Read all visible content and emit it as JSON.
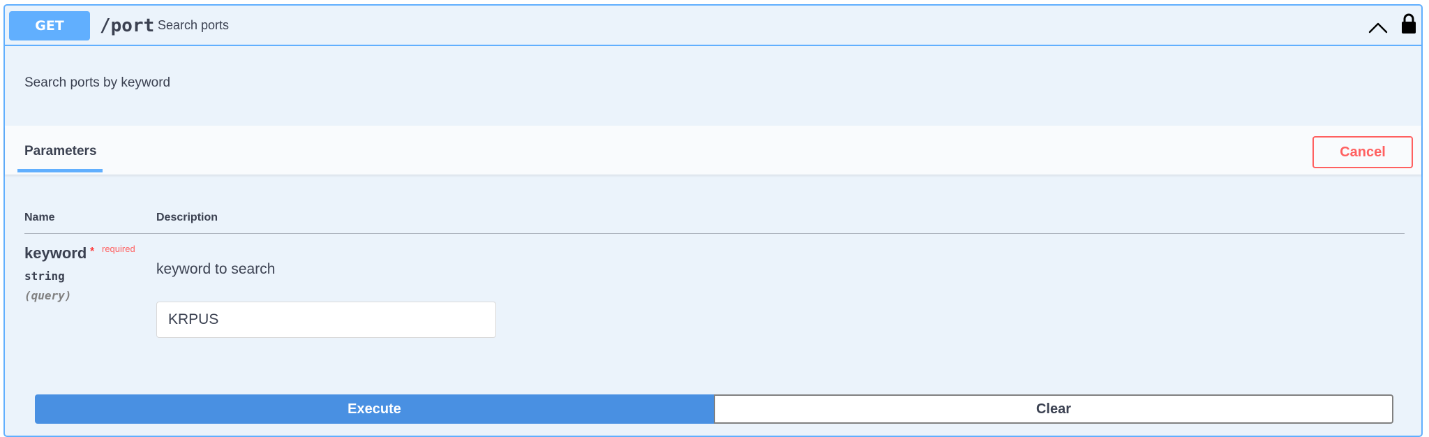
{
  "operation": {
    "method": "GET",
    "path": "/port",
    "summary": "Search ports",
    "description": "Search ports by keyword",
    "method_color": "#61affe"
  },
  "icons": {
    "collapse": "chevron-up-icon",
    "auth": "lock-icon"
  },
  "parameters_section": {
    "tab_label": "Parameters",
    "cancel_label": "Cancel",
    "columns": {
      "name": "Name",
      "description": "Description"
    },
    "params": [
      {
        "name": "keyword",
        "required_marker": "*",
        "required_label": "required",
        "type": "string",
        "in": "(query)",
        "description": "keyword to search",
        "value": "KRPUS"
      }
    ]
  },
  "actions": {
    "execute_label": "Execute",
    "clear_label": "Clear",
    "execute_color": "#4990e2"
  }
}
